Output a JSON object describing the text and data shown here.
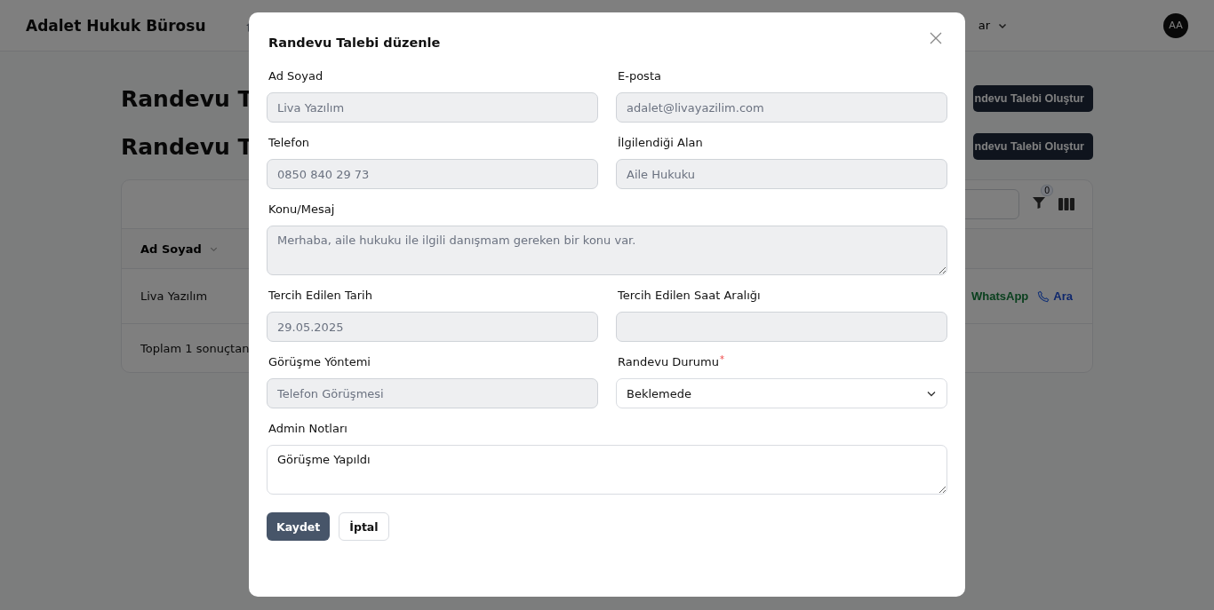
{
  "header": {
    "brand": "Adalet Hukuk Bürosu",
    "nav_text": "ar",
    "avatar": "AA"
  },
  "page": {
    "headings": [
      "Randevu T",
      "Randevu T"
    ],
    "create_buttons": [
      "ndevu Talebi Oluştur",
      "ndevu Talebi Oluştur"
    ]
  },
  "table": {
    "filter_count": "0",
    "columns": [
      "Ad Soyad"
    ],
    "rows": [
      {
        "name": "Liva Yazılım",
        "whatsapp": "WhatsApp",
        "call": "Ara"
      }
    ],
    "footer": "Toplam 1 sonuçtan"
  },
  "modal": {
    "title": "Randevu Talebi düzenle",
    "fields": [
      {
        "label": "Ad Soyad",
        "kind": "input",
        "value": "Liva Yazılım",
        "disabled": true
      },
      {
        "label": "E-posta",
        "kind": "input",
        "value": "adalet@livayazilim.com",
        "disabled": true
      },
      {
        "label": "Telefon",
        "kind": "input",
        "value": "0850 840 29 73",
        "disabled": true
      },
      {
        "label": "İlgilendiği Alan",
        "kind": "input",
        "value": "Aile Hukuku",
        "disabled": true
      },
      {
        "label": "Konu/Mesaj",
        "kind": "textarea",
        "value": "Merhaba, aile hukuku ile ilgili danışmam gereken bir konu var.",
        "disabled": true
      },
      {
        "label": "Tercih Edilen Tarih",
        "kind": "input",
        "value": "29.05.2025",
        "disabled": true
      },
      {
        "label": "Tercih Edilen Saat Aralığı",
        "kind": "input",
        "disabled": true
      },
      {
        "label": "Görüşme Yöntemi",
        "kind": "input",
        "value": "Telefon Görüşmesi",
        "disabled": true
      },
      {
        "label": "Randevu Durumu",
        "kind": "select",
        "value": "Beklemede",
        "disabled": false,
        "required_mark": "*"
      },
      {
        "label": "Admin Notları",
        "kind": "textarea",
        "value": "Görüşme Yapıldı",
        "disabled": false
      }
    ],
    "buttons": [
      {
        "label": "Kaydet",
        "kind": "primary"
      },
      {
        "label": "İptal",
        "kind": "secondary"
      }
    ]
  }
}
